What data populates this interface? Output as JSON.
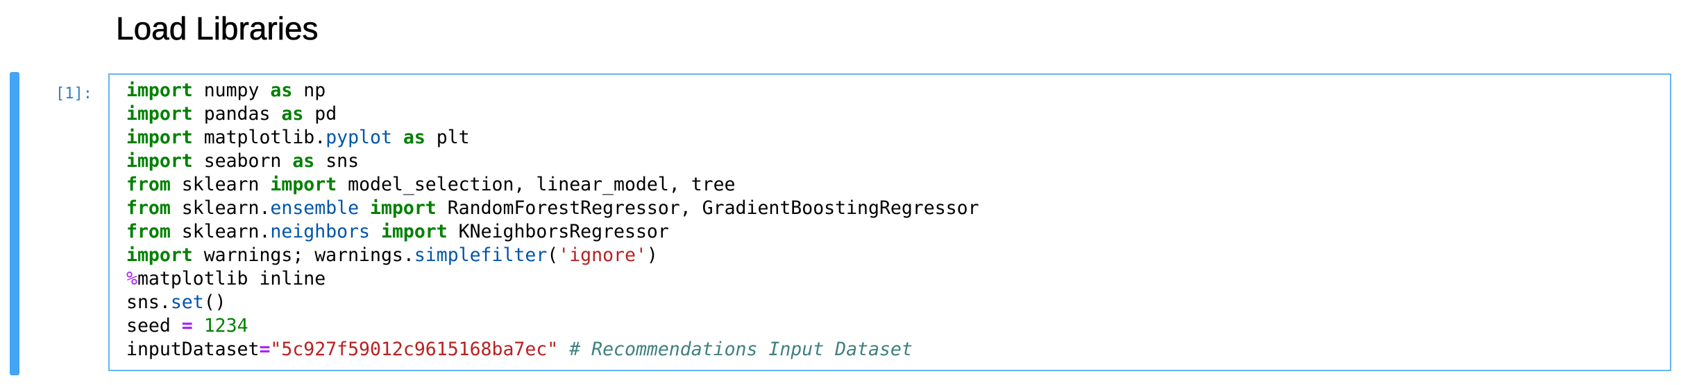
{
  "heading": "Load Libraries",
  "cell": {
    "prompt": "[1]:",
    "lines": [
      [
        {
          "t": "kw",
          "v": "import"
        },
        {
          "t": "plain",
          "v": " numpy "
        },
        {
          "t": "kw",
          "v": "as"
        },
        {
          "t": "plain",
          "v": " np"
        }
      ],
      [
        {
          "t": "kw",
          "v": "import"
        },
        {
          "t": "plain",
          "v": " pandas "
        },
        {
          "t": "kw",
          "v": "as"
        },
        {
          "t": "plain",
          "v": " pd"
        }
      ],
      [
        {
          "t": "kw",
          "v": "import"
        },
        {
          "t": "plain",
          "v": " matplotlib."
        },
        {
          "t": "attr",
          "v": "pyplot"
        },
        {
          "t": "plain",
          "v": " "
        },
        {
          "t": "kw",
          "v": "as"
        },
        {
          "t": "plain",
          "v": " plt"
        }
      ],
      [
        {
          "t": "kw",
          "v": "import"
        },
        {
          "t": "plain",
          "v": " seaborn "
        },
        {
          "t": "kw",
          "v": "as"
        },
        {
          "t": "plain",
          "v": " sns"
        }
      ],
      [
        {
          "t": "kw",
          "v": "from"
        },
        {
          "t": "plain",
          "v": " sklearn "
        },
        {
          "t": "kw",
          "v": "import"
        },
        {
          "t": "plain",
          "v": " model_selection, linear_model, tree"
        }
      ],
      [
        {
          "t": "kw",
          "v": "from"
        },
        {
          "t": "plain",
          "v": " sklearn."
        },
        {
          "t": "attr",
          "v": "ensemble"
        },
        {
          "t": "plain",
          "v": " "
        },
        {
          "t": "kw",
          "v": "import"
        },
        {
          "t": "plain",
          "v": " RandomForestRegressor, GradientBoostingRegressor"
        }
      ],
      [
        {
          "t": "kw",
          "v": "from"
        },
        {
          "t": "plain",
          "v": " sklearn."
        },
        {
          "t": "attr",
          "v": "neighbors"
        },
        {
          "t": "plain",
          "v": " "
        },
        {
          "t": "kw",
          "v": "import"
        },
        {
          "t": "plain",
          "v": " KNeighborsRegressor"
        }
      ],
      [
        {
          "t": "kw",
          "v": "import"
        },
        {
          "t": "plain",
          "v": " warnings; warnings."
        },
        {
          "t": "attr",
          "v": "simplefilter"
        },
        {
          "t": "plain",
          "v": "("
        },
        {
          "t": "str",
          "v": "'ignore'"
        },
        {
          "t": "plain",
          "v": ")"
        }
      ],
      [
        {
          "t": "magic",
          "v": "%"
        },
        {
          "t": "plain",
          "v": "matplotlib inline"
        }
      ],
      [
        {
          "t": "plain",
          "v": "sns."
        },
        {
          "t": "attr",
          "v": "set"
        },
        {
          "t": "plain",
          "v": "()"
        }
      ],
      [
        {
          "t": "plain",
          "v": "seed "
        },
        {
          "t": "op",
          "v": "="
        },
        {
          "t": "plain",
          "v": " "
        },
        {
          "t": "num",
          "v": "1234"
        }
      ],
      [
        {
          "t": "plain",
          "v": "inputDataset"
        },
        {
          "t": "op",
          "v": "="
        },
        {
          "t": "str",
          "v": "\"5c927f59012c9615168ba7ec\""
        },
        {
          "t": "plain",
          "v": " "
        },
        {
          "t": "cm",
          "v": "# Recommendations Input Dataset"
        }
      ]
    ]
  }
}
